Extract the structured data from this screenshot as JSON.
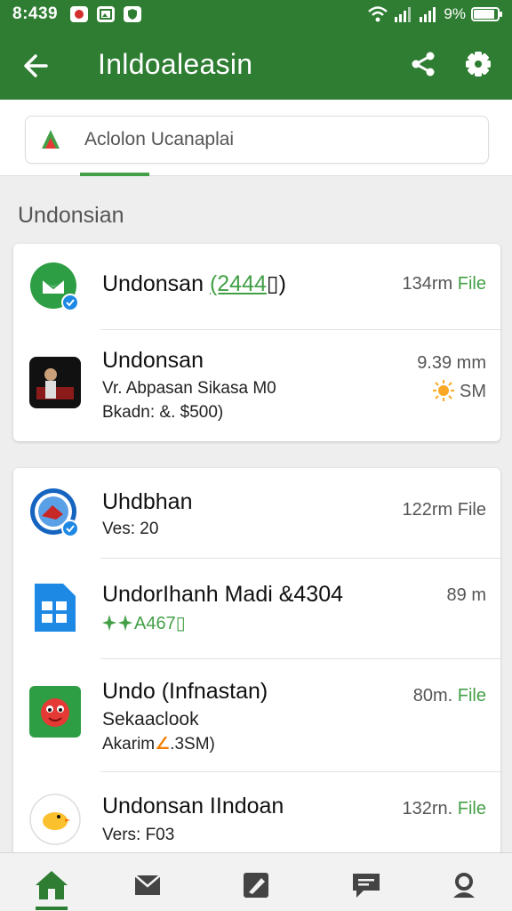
{
  "status_bar": {
    "time": "8:439",
    "battery_text": "9%",
    "battery_level": 0.9
  },
  "app_bar": {
    "title": "Inldoaleasin"
  },
  "search": {
    "text": "Aclolon Ucanaplai"
  },
  "section": {
    "title": "Undonsian"
  },
  "cards": [
    {
      "items": [
        {
          "title": "Undonsan",
          "title_highlight": "(2444",
          "title_suffix": "▯)",
          "sub1": "",
          "sub2": "",
          "meta": "134rm",
          "meta_file": "File"
        },
        {
          "title": "Undonsan",
          "title_highlight": "",
          "title_suffix": "",
          "sub1": "Vr. Abpasan Sikasa M0",
          "sub2": "Bkadn: &. $500)",
          "meta": "9.39 mm",
          "meta2": "SM"
        }
      ]
    },
    {
      "items": [
        {
          "title": "Uhdbhan",
          "sub1": "Ves: 20",
          "meta": "122rm",
          "meta_file": "File"
        },
        {
          "title": "UndorIhanh Madi &4304",
          "sub1": "A467▯",
          "meta": "89 m"
        },
        {
          "title": "Undo (Infnastan)",
          "sub1": "Sekaaclook",
          "sub2_a": "Akarim",
          "sub2_b": ".3SM)",
          "meta": "80m.",
          "meta_file": "File"
        },
        {
          "title": "Undonsan IIndoan",
          "sub1": "Vers: F03",
          "meta": "132rn.",
          "meta_file": "File"
        }
      ]
    }
  ],
  "colors": {
    "primary": "#2e7d32",
    "accent": "#43a047",
    "background": "#eeeeee"
  },
  "icons": {
    "back": "arrow-left-icon",
    "share": "share-icon",
    "settings": "gear-icon",
    "nav": [
      "home-icon",
      "mail-icon",
      "edit-icon",
      "chat-icon",
      "profile-icon"
    ]
  }
}
